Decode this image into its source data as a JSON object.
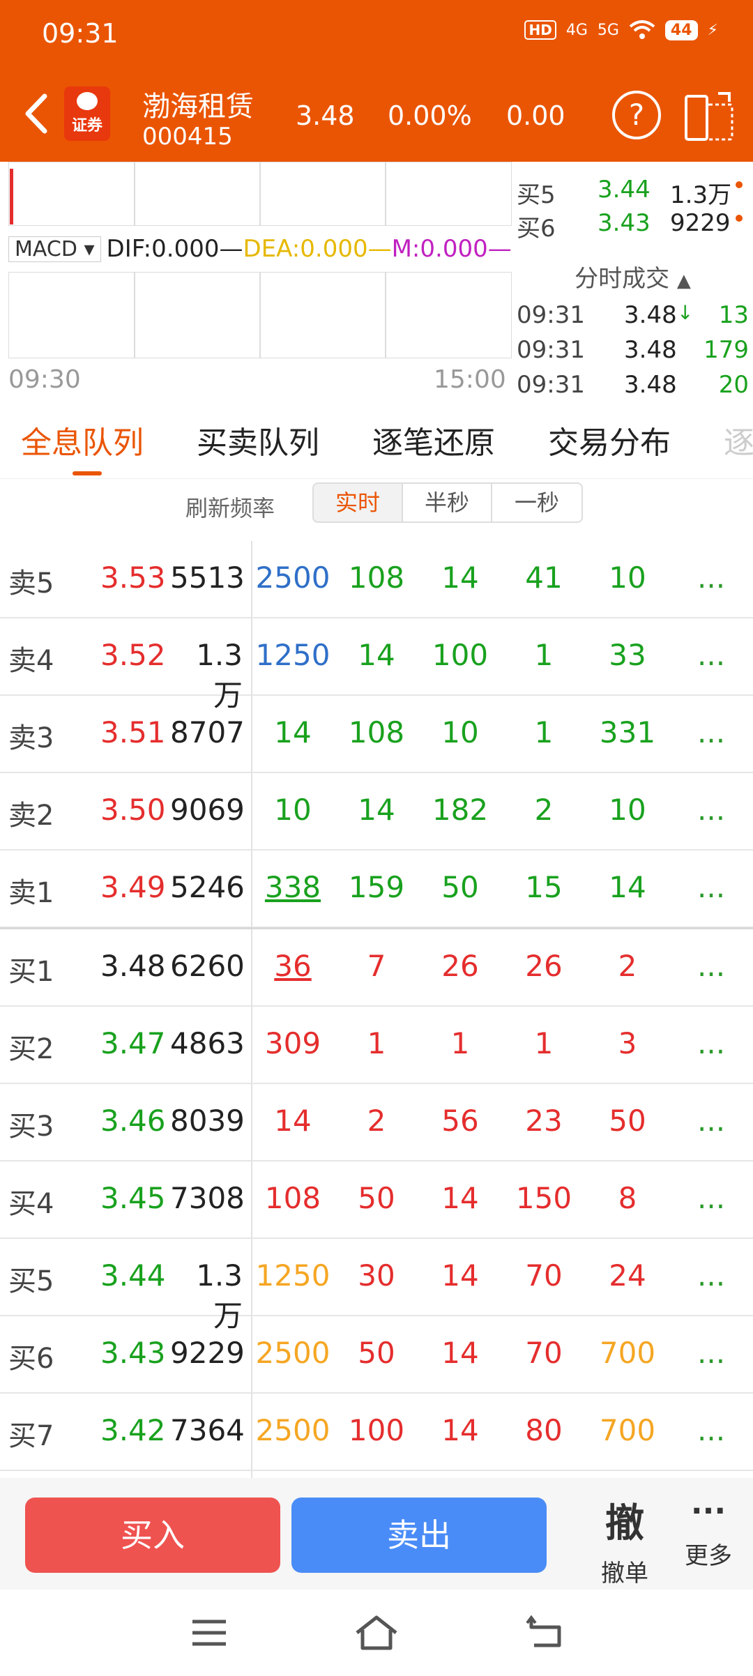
{
  "status": {
    "time": "09:31",
    "hd": "HD",
    "net1": "4G",
    "net2": "5G",
    "battery": "44"
  },
  "header": {
    "logo_text": "证券",
    "stock_name": "渤海租赁",
    "stock_code": "000415",
    "price": "3.48",
    "change_pct": "0.00%",
    "change": "0.00",
    "help": "?"
  },
  "chart": {
    "macd_select": "MACD",
    "dif": "DIF:0.000",
    "dea": "DEA:0.000",
    "m": "M:0.000",
    "start_time": "09:30",
    "end_time": "15:00",
    "dif_color": "#222222",
    "dea_color": "#e6b800",
    "m_color": "#c020c0"
  },
  "right_panel": {
    "book": [
      {
        "label": "买5",
        "price": "3.44",
        "vol": "1.3万"
      },
      {
        "label": "买6",
        "price": "3.43",
        "vol": "9229"
      }
    ],
    "trades_title": "分时成交",
    "trades": [
      {
        "time": "09:31",
        "price": "3.48",
        "arrow": "↓",
        "vol": "13"
      },
      {
        "time": "09:31",
        "price": "3.48",
        "arrow": "",
        "vol": "179"
      },
      {
        "time": "09:31",
        "price": "3.48",
        "arrow": "",
        "vol": "20"
      }
    ]
  },
  "tabs": [
    "全息队列",
    "买卖队列",
    "逐笔还原",
    "交易分布",
    "逐"
  ],
  "refresh": {
    "label": "刷新频率",
    "options": [
      "实时",
      "半秒",
      "一秒"
    ],
    "selected": "实时"
  },
  "queue": [
    {
      "label": "卖5",
      "price": "3.53",
      "vol": "5513",
      "q": [
        "2500",
        "108",
        "14",
        "41",
        "10"
      ],
      "more": "..."
    },
    {
      "label": "卖4",
      "price": "3.52",
      "vol": "1.3万",
      "q": [
        "1250",
        "14",
        "100",
        "1",
        "33"
      ],
      "more": "..."
    },
    {
      "label": "卖3",
      "price": "3.51",
      "vol": "8707",
      "q": [
        "14",
        "108",
        "10",
        "1",
        "331"
      ],
      "more": "..."
    },
    {
      "label": "卖2",
      "price": "3.50",
      "vol": "9069",
      "q": [
        "10",
        "14",
        "182",
        "2",
        "10"
      ],
      "more": "..."
    },
    {
      "label": "卖1",
      "price": "3.49",
      "vol": "5246",
      "q": [
        "338",
        "159",
        "50",
        "15",
        "14"
      ],
      "more": "..."
    },
    {
      "label": "买1",
      "price": "3.48",
      "vol": "6260",
      "q": [
        "36",
        "7",
        "26",
        "26",
        "2"
      ],
      "more": "..."
    },
    {
      "label": "买2",
      "price": "3.47",
      "vol": "4863",
      "q": [
        "309",
        "1",
        "1",
        "1",
        "3"
      ],
      "more": "..."
    },
    {
      "label": "买3",
      "price": "3.46",
      "vol": "8039",
      "q": [
        "14",
        "2",
        "56",
        "23",
        "50"
      ],
      "more": "..."
    },
    {
      "label": "买4",
      "price": "3.45",
      "vol": "7308",
      "q": [
        "108",
        "50",
        "14",
        "150",
        "8"
      ],
      "more": "..."
    },
    {
      "label": "买5",
      "price": "3.44",
      "vol": "1.3万",
      "q": [
        "1250",
        "30",
        "14",
        "70",
        "24"
      ],
      "more": "..."
    },
    {
      "label": "买6",
      "price": "3.43",
      "vol": "9229",
      "q": [
        "2500",
        "50",
        "14",
        "70",
        "700"
      ],
      "more": "..."
    },
    {
      "label": "买7",
      "price": "3.42",
      "vol": "7364",
      "q": [
        "2500",
        "100",
        "14",
        "80",
        "700"
      ],
      "more": "..."
    }
  ],
  "bottom": {
    "buy": "买入",
    "sell": "卖出",
    "cancel_icon": "撤",
    "cancel": "撤单",
    "more_icon": "···",
    "more": "更多"
  }
}
